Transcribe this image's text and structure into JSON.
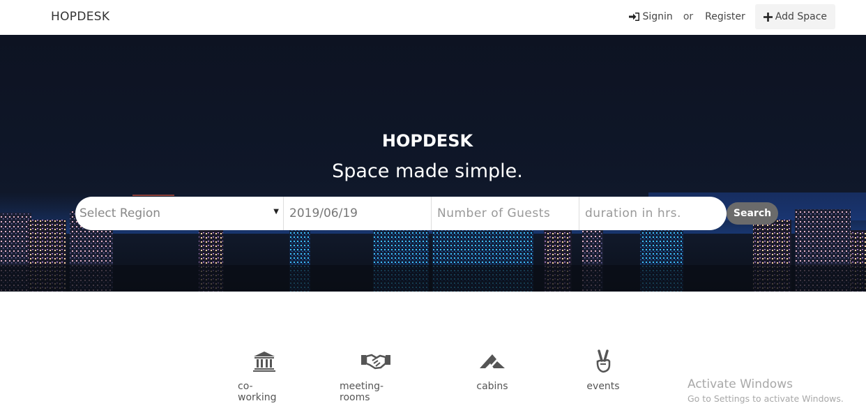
{
  "navbar": {
    "brand": "HOPDESK",
    "signin": "Signin",
    "or": "or",
    "register": "Register",
    "add_space": "Add Space"
  },
  "hero": {
    "title": "HOPDESK",
    "subtitle": "Space made simple.",
    "accent_color": "#4a63d8"
  },
  "search": {
    "region": "Select Region",
    "date": "2019/06/19",
    "guests_placeholder": "Number of Guests",
    "duration_placeholder": "duration in hrs.",
    "button": "Search"
  },
  "categories": [
    {
      "label": "co-working",
      "icon": "bank-icon"
    },
    {
      "label": "meeting-rooms",
      "icon": "handshake-icon"
    },
    {
      "label": "cabins",
      "icon": "cabin-logo-icon"
    },
    {
      "label": "events",
      "icon": "peace-hand-icon"
    }
  ],
  "watermark": {
    "title": "Activate Windows",
    "subtitle": "Go to Settings to activate Windows."
  }
}
